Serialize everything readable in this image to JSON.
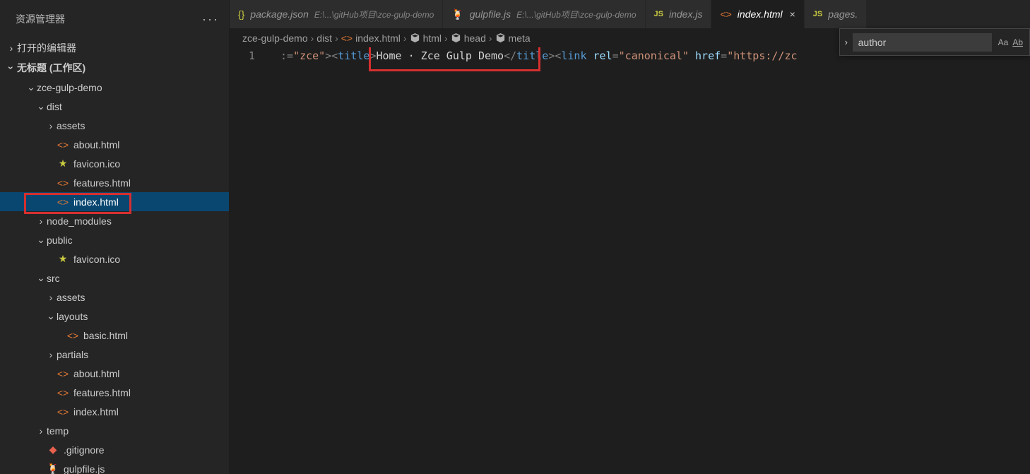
{
  "sidebar": {
    "title": "资源管理器",
    "sections": {
      "openEditors": "打开的编辑器",
      "workspace": "无标题 (工作区)"
    },
    "tree": [
      {
        "indent": 1,
        "type": "folder",
        "open": true,
        "label": "zce-gulp-demo"
      },
      {
        "indent": 2,
        "type": "folder",
        "open": true,
        "label": "dist"
      },
      {
        "indent": 3,
        "type": "folder",
        "open": false,
        "label": "assets"
      },
      {
        "indent": 3,
        "type": "html",
        "label": "about.html"
      },
      {
        "indent": 3,
        "type": "star",
        "label": "favicon.ico"
      },
      {
        "indent": 3,
        "type": "html",
        "label": "features.html"
      },
      {
        "indent": 3,
        "type": "html",
        "label": "index.html",
        "selected": true
      },
      {
        "indent": 2,
        "type": "folder",
        "open": false,
        "label": "node_modules"
      },
      {
        "indent": 2,
        "type": "folder",
        "open": true,
        "label": "public"
      },
      {
        "indent": 3,
        "type": "star",
        "label": "favicon.ico"
      },
      {
        "indent": 2,
        "type": "folder",
        "open": true,
        "label": "src"
      },
      {
        "indent": 3,
        "type": "folder",
        "open": false,
        "label": "assets"
      },
      {
        "indent": 3,
        "type": "folder",
        "open": true,
        "label": "layouts"
      },
      {
        "indent": 4,
        "type": "html",
        "label": "basic.html"
      },
      {
        "indent": 3,
        "type": "folder",
        "open": false,
        "label": "partials"
      },
      {
        "indent": 3,
        "type": "html",
        "label": "about.html"
      },
      {
        "indent": 3,
        "type": "html",
        "label": "features.html"
      },
      {
        "indent": 3,
        "type": "html",
        "label": "index.html"
      },
      {
        "indent": 2,
        "type": "folder",
        "open": false,
        "label": "temp"
      },
      {
        "indent": 2,
        "type": "git",
        "label": ".gitignore"
      },
      {
        "indent": 2,
        "type": "gulp",
        "label": "gulpfile.js"
      }
    ]
  },
  "tabs": [
    {
      "icon": "braces",
      "title": "package.json",
      "path": "E:\\...\\gitHub项目\\zce-gulp-demo",
      "active": false
    },
    {
      "icon": "gulp",
      "title": "gulpfile.js",
      "path": "E:\\...\\gitHub项目\\zce-gulp-demo",
      "active": false
    },
    {
      "icon": "js",
      "title": "index.js",
      "path": "",
      "active": false
    },
    {
      "icon": "html",
      "title": "index.html",
      "path": "",
      "active": true,
      "close": true
    },
    {
      "icon": "js",
      "title": "pages.",
      "path": "",
      "active": false
    }
  ],
  "breadcrumb": [
    "zce-gulp-demo",
    "dist",
    "index.html",
    "html",
    "head",
    "meta"
  ],
  "editor": {
    "line_number": "1",
    "code_pre": ":=",
    "code_str1": "\"zce\"",
    "tag_title_open": "title",
    "title_text": "Home · Zce Gulp Demo",
    "tag_title_close": "title",
    "tag_link": "link",
    "attr_rel": "rel",
    "val_rel": "\"canonical\"",
    "attr_href": "href",
    "val_href": "\"https://zc"
  },
  "search": {
    "value": "author",
    "opt_case": "Aa",
    "opt_word": "Ab"
  }
}
